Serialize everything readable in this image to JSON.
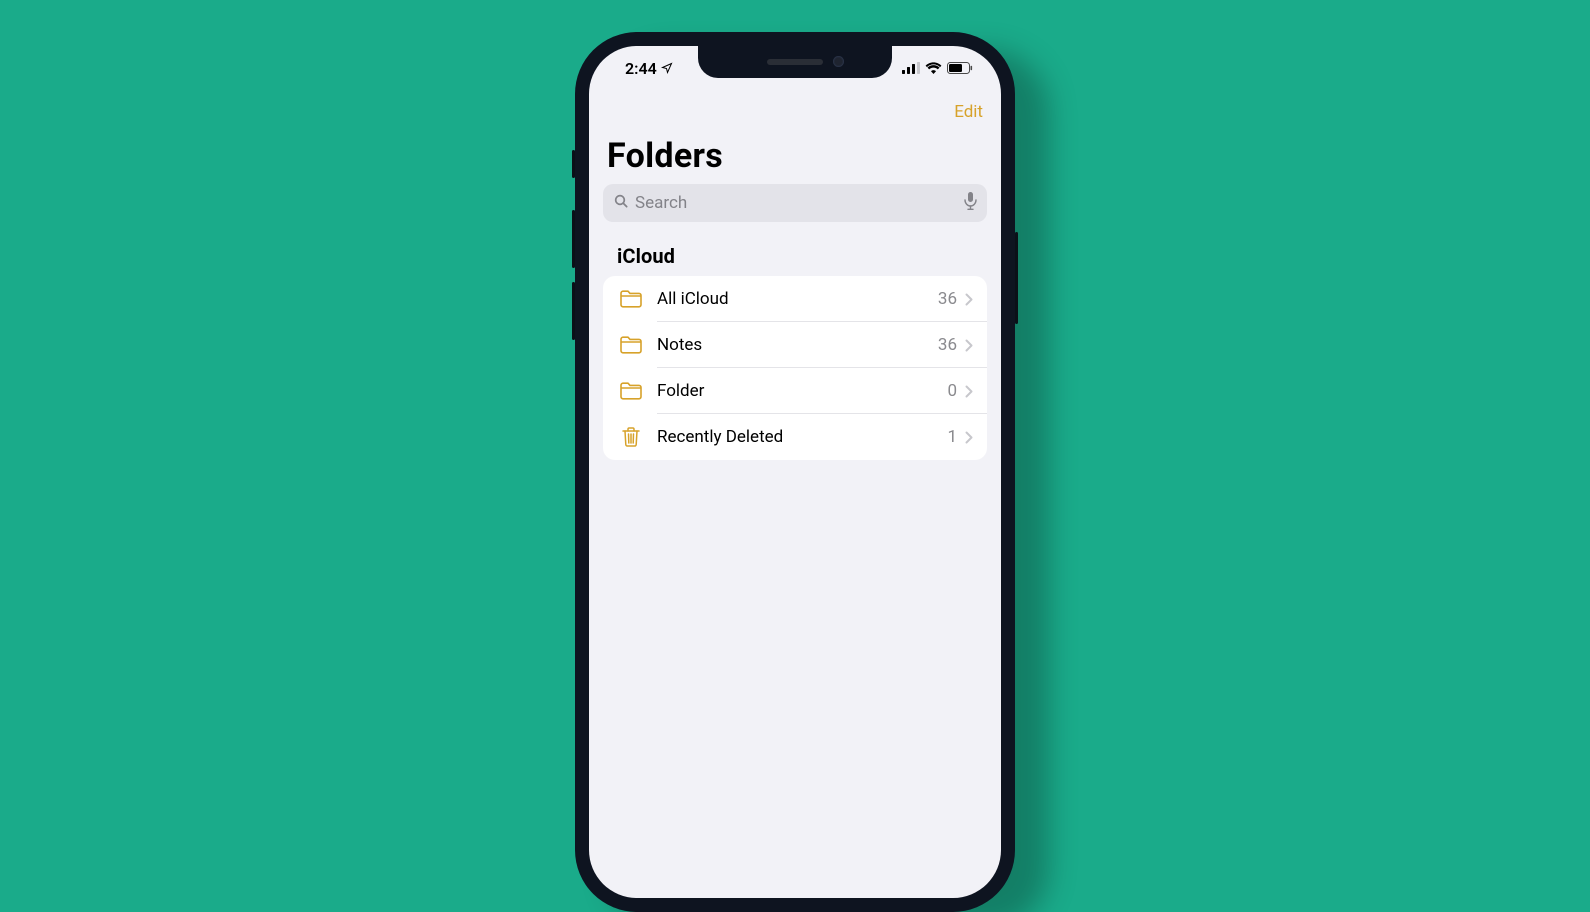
{
  "statusBar": {
    "time": "2:44"
  },
  "nav": {
    "edit": "Edit"
  },
  "page": {
    "title": "Folders"
  },
  "search": {
    "placeholder": "Search"
  },
  "section": {
    "header": "iCloud"
  },
  "folders": [
    {
      "icon": "folder",
      "label": "All iCloud",
      "count": "36"
    },
    {
      "icon": "folder",
      "label": "Notes",
      "count": "36"
    },
    {
      "icon": "folder",
      "label": "Folder",
      "count": "0"
    },
    {
      "icon": "trash",
      "label": "Recently Deleted",
      "count": "1"
    }
  ],
  "colors": {
    "accent": "#d7a22a",
    "background": "#1aab8a"
  }
}
